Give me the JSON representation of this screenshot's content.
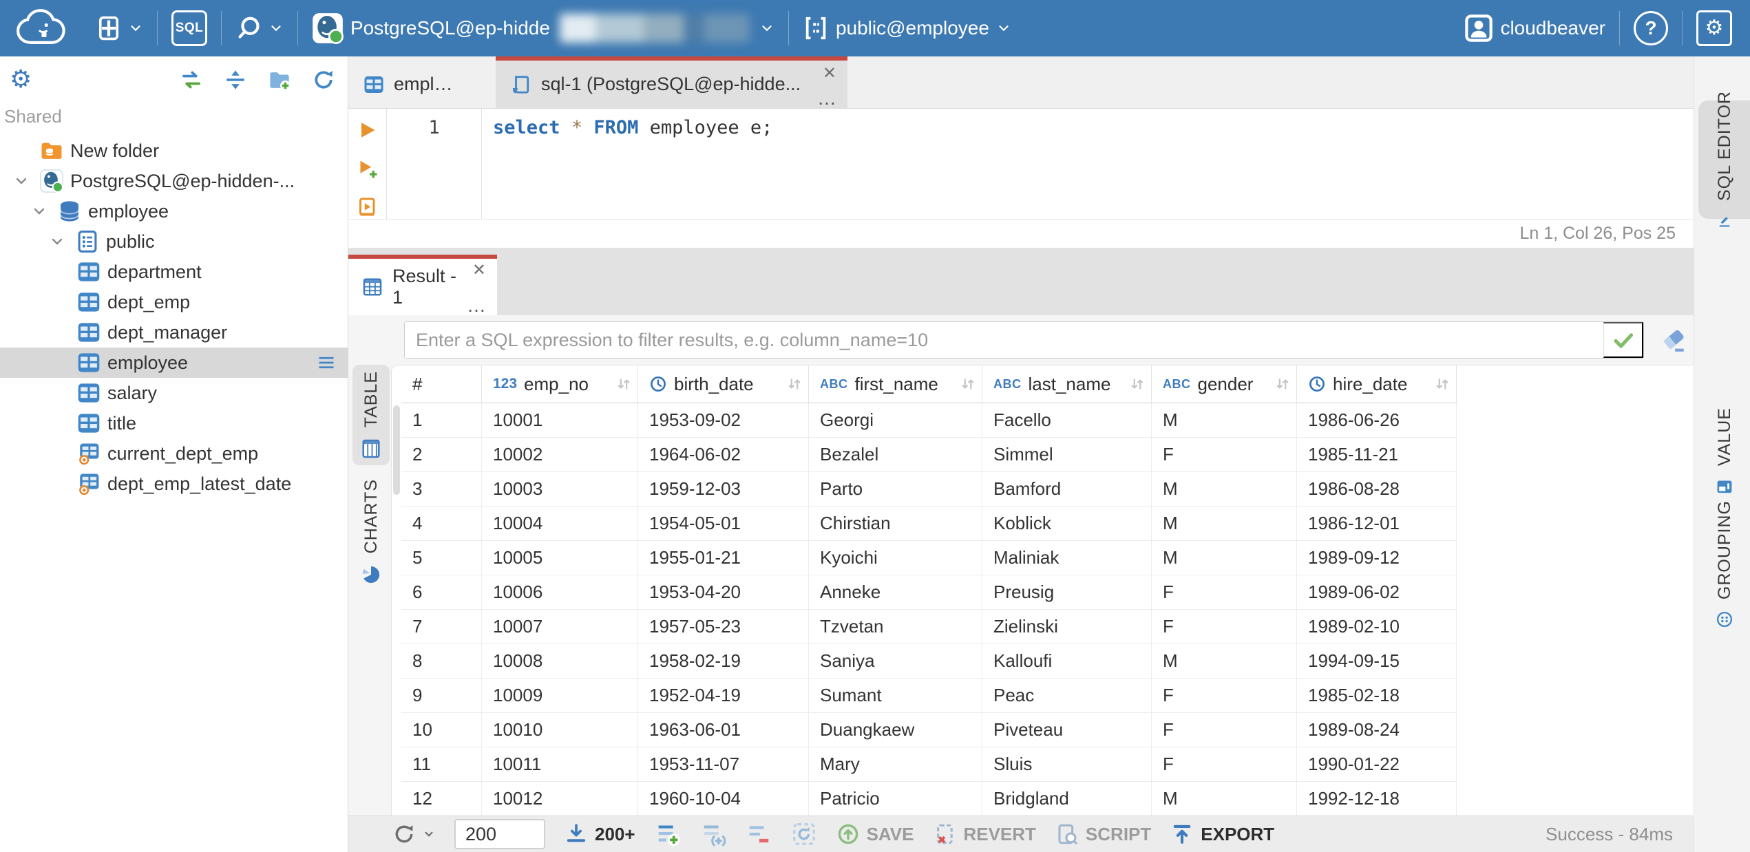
{
  "icons": {
    "gear": "⚙",
    "help": "?",
    "close": "✕",
    "more": "…"
  },
  "topbar": {
    "sql_badge": "SQL",
    "connection": {
      "visible_name": "PostgreSQL@ep-hidde",
      "schema": "public@employee"
    },
    "user_name": "cloudbeaver"
  },
  "sidebar": {
    "section_label": "Shared",
    "tree": [
      {
        "label": "New folder",
        "icon": "folder-database-icon",
        "level": 0,
        "chevron": false,
        "selected": false
      },
      {
        "label": "PostgreSQL@ep-hidden-...",
        "icon": "postgresql-icon",
        "level": 0,
        "chevron": true,
        "selected": false
      },
      {
        "label": "employee",
        "icon": "database-icon",
        "level": 1,
        "chevron": true,
        "selected": false
      },
      {
        "label": "public",
        "icon": "schema-icon",
        "level": 2,
        "chevron": true,
        "selected": false
      },
      {
        "label": "department",
        "icon": "table-icon",
        "level": 3,
        "chevron": false,
        "selected": false
      },
      {
        "label": "dept_emp",
        "icon": "table-icon",
        "level": 3,
        "chevron": false,
        "selected": false
      },
      {
        "label": "dept_manager",
        "icon": "table-icon",
        "level": 3,
        "chevron": false,
        "selected": false
      },
      {
        "label": "employee",
        "icon": "table-icon",
        "level": 3,
        "chevron": false,
        "selected": true
      },
      {
        "label": "salary",
        "icon": "table-icon",
        "level": 3,
        "chevron": false,
        "selected": false
      },
      {
        "label": "title",
        "icon": "table-icon",
        "level": 3,
        "chevron": false,
        "selected": false
      },
      {
        "label": "current_dept_emp",
        "icon": "view-icon",
        "level": 3,
        "chevron": false,
        "selected": false
      },
      {
        "label": "dept_emp_latest_date",
        "icon": "view-icon",
        "level": 3,
        "chevron": false,
        "selected": false
      }
    ]
  },
  "editor": {
    "tabs": [
      {
        "label": "employee"
      },
      {
        "label": "sql-1 (PostgreSQL@ep-hidde..."
      }
    ],
    "line_number": "1",
    "code_tokens": [
      {
        "text": "select",
        "type": "keyword"
      },
      {
        "text": " ",
        "type": "plain"
      },
      {
        "text": "*",
        "type": "operator"
      },
      {
        "text": " ",
        "type": "plain"
      },
      {
        "text": "FROM",
        "type": "keyword"
      },
      {
        "text": " employee e;",
        "type": "plain"
      }
    ],
    "status_position": "Ln 1, Col 26, Pos 25",
    "side_tab_label": "SQL EDITOR"
  },
  "result": {
    "tab_label": "Result - 1",
    "filter_placeholder": "Enter a SQL expression to filter results, e.g. column_name=10",
    "left_tabs": [
      {
        "label": "TABLE"
      },
      {
        "label": "CHARTS"
      }
    ],
    "right_tabs": [
      {
        "label": "VALUE"
      },
      {
        "label": "GROUPING"
      }
    ],
    "grid": {
      "row_header": "#",
      "columns": [
        {
          "name": "emp_no",
          "type_icon": "123"
        },
        {
          "name": "birth_date",
          "type_icon": "clock"
        },
        {
          "name": "first_name",
          "type_icon": "ABC"
        },
        {
          "name": "last_name",
          "type_icon": "ABC"
        },
        {
          "name": "gender",
          "type_icon": "ABC"
        },
        {
          "name": "hire_date",
          "type_icon": "clock"
        }
      ],
      "rows": [
        [
          "1",
          "10001",
          "1953-09-02",
          "Georgi",
          "Facello",
          "M",
          "1986-06-26"
        ],
        [
          "2",
          "10002",
          "1964-06-02",
          "Bezalel",
          "Simmel",
          "F",
          "1985-11-21"
        ],
        [
          "3",
          "10003",
          "1959-12-03",
          "Parto",
          "Bamford",
          "M",
          "1986-08-28"
        ],
        [
          "4",
          "10004",
          "1954-05-01",
          "Chirstian",
          "Koblick",
          "M",
          "1986-12-01"
        ],
        [
          "5",
          "10005",
          "1955-01-21",
          "Kyoichi",
          "Maliniak",
          "M",
          "1989-09-12"
        ],
        [
          "6",
          "10006",
          "1953-04-20",
          "Anneke",
          "Preusig",
          "F",
          "1989-06-02"
        ],
        [
          "7",
          "10007",
          "1957-05-23",
          "Tzvetan",
          "Zielinski",
          "F",
          "1989-02-10"
        ],
        [
          "8",
          "10008",
          "1958-02-19",
          "Saniya",
          "Kalloufi",
          "M",
          "1994-09-15"
        ],
        [
          "9",
          "10009",
          "1952-04-19",
          "Sumant",
          "Peac",
          "F",
          "1985-02-18"
        ],
        [
          "10",
          "10010",
          "1963-06-01",
          "Duangkaew",
          "Piveteau",
          "F",
          "1989-08-24"
        ],
        [
          "11",
          "10011",
          "1953-11-07",
          "Mary",
          "Sluis",
          "F",
          "1990-01-22"
        ],
        [
          "12",
          "10012",
          "1960-10-04",
          "Patricio",
          "Bridgland",
          "M",
          "1992-12-18"
        ]
      ]
    },
    "toolbar": {
      "row_limit_value": "200",
      "fetch_more_label": "200+",
      "save_label": "SAVE",
      "revert_label": "REVERT",
      "script_label": "SCRIPT",
      "export_label": "EXPORT",
      "status": "Success - 84ms"
    }
  }
}
